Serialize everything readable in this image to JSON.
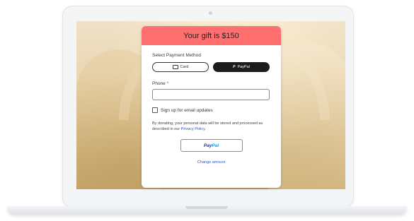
{
  "header": {
    "title": "Your gift is $150"
  },
  "payment": {
    "label": "Select Payment Method",
    "options": [
      {
        "label": "Card",
        "selected": false
      },
      {
        "label": "PayPal",
        "selected": true
      }
    ]
  },
  "phone": {
    "label": "Phone",
    "required_marker": "*",
    "value": ""
  },
  "email_updates": {
    "label": "Sign up for email updates",
    "checked": false
  },
  "disclaimer": {
    "text": "By donating, your personal data will be stored and processed as described in our ",
    "link": "Privacy Policy",
    "end": "."
  },
  "paypal_button": {
    "pay": "Pay",
    "pal": "Pal"
  },
  "change_amount": "Change amount",
  "colors": {
    "header": "#ff6f6f",
    "link": "#2a57c9",
    "toggle_selected": "#1c1c1c"
  }
}
